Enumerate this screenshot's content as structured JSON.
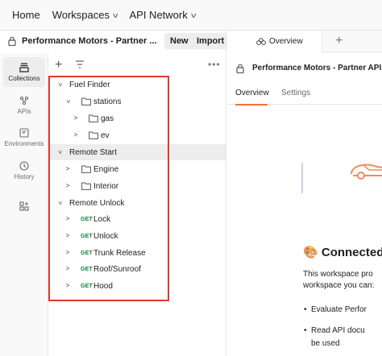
{
  "topnav": {
    "home": "Home",
    "workspaces": "Workspaces",
    "api_network": "API Network"
  },
  "workspace": {
    "title": "Performance Motors - Partner ...",
    "new_label": "New",
    "import_label": "Import"
  },
  "rail": {
    "collections": "Collections",
    "apis": "APIs",
    "environments": "Environments",
    "history": "History"
  },
  "tree": {
    "fuel_finder": "Fuel Finder",
    "stations": "stations",
    "gas": "gas",
    "ev": "ev",
    "remote_start": "Remote Start",
    "engine": "Engine",
    "interior": "Interior",
    "remote_unlock": "Remote Unlock",
    "method": "GET",
    "lock": "Lock",
    "unlock": "Unlock",
    "trunk_release": "Trunk Release",
    "roof_sunroof": "Roof/Sunroof",
    "hood": "Hood"
  },
  "right": {
    "tab_label": "Overview",
    "doc_title": "Performance Motors - Partner API dem",
    "subtab_overview": "Overview",
    "subtab_settings": "Settings",
    "heading": "Connected",
    "para1": "This workspace pro",
    "para2": "workspace you can:",
    "bullet1": "Evaluate Perfor",
    "bullet2": "Read API docu",
    "bullet2_cont": "be used"
  },
  "colors": {
    "accent": "#ff6c37",
    "get_method": "#0f7d3e",
    "highlight_box": "#e03a2f"
  }
}
